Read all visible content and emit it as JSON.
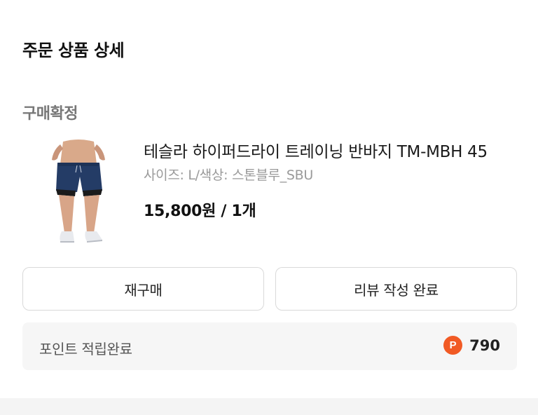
{
  "header": {
    "title": "주문 상품 상세"
  },
  "order": {
    "status": "구매확정",
    "product": {
      "image_icon": "shorts-product-image",
      "name": "테슬라 하이퍼드라이 트레이닝 반바지 TM-MBH 45",
      "option": "사이즈: L/색상: 스톤블루_SBU",
      "price_qty": "15,800원 / 1개"
    }
  },
  "actions": {
    "rebuy_label": "재구매",
    "review_label": "리뷰 작성 완료"
  },
  "points": {
    "label": "포인트 적립완료",
    "icon_text": "P",
    "value": "790",
    "icon_color": "#f15a24"
  }
}
